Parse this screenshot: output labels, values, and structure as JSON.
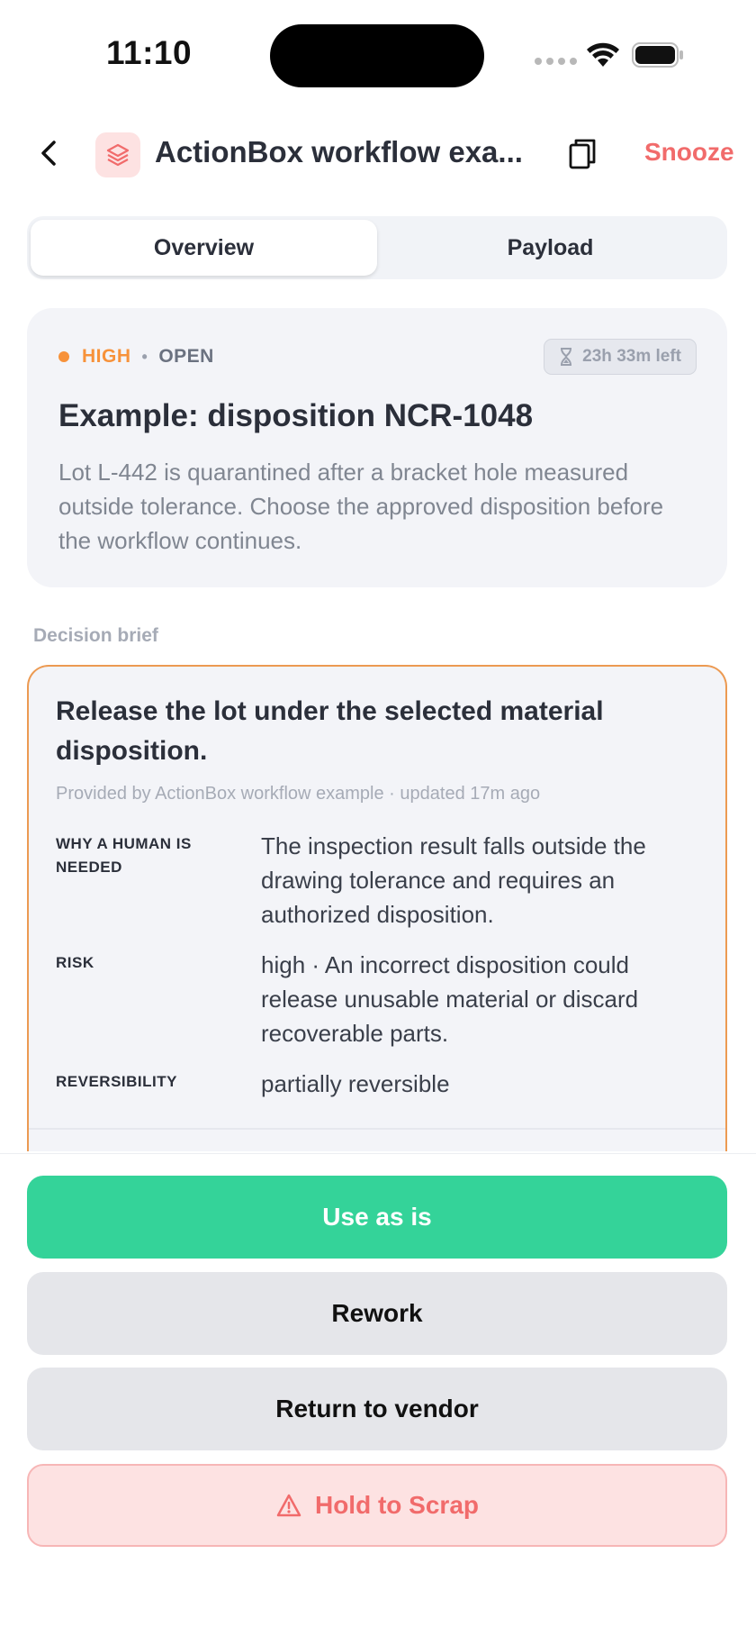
{
  "status_bar": {
    "time": "11:10"
  },
  "header": {
    "title": "ActionBox workflow exa...",
    "snooze_label": "Snooze"
  },
  "tabs": [
    {
      "label": "Overview",
      "active": true
    },
    {
      "label": "Payload",
      "active": false
    }
  ],
  "summary": {
    "priority": "HIGH",
    "separator": "•",
    "state": "OPEN",
    "time_left": "23h 33m left",
    "title": "Example: disposition NCR-1048",
    "description": "Lot L-442 is quarantined after a bracket hole measured outside tolerance. Choose the approved disposition before the workflow continues."
  },
  "decision_brief": {
    "section_label": "Decision brief",
    "title": "Release the lot under the selected material disposition.",
    "meta": "Provided by ActionBox workflow example · updated 17m ago",
    "fields": [
      {
        "key": "WHY A HUMAN IS NEEDED",
        "value": "The inspection result falls outside the drawing tolerance and requires an authorized disposition."
      },
      {
        "key": "RISK",
        "value": "high · An incorrect disposition could release unusable material or discard recoverable parts."
      },
      {
        "key": "REVERSIBILITY",
        "value": "partially reversible"
      }
    ]
  },
  "actions": {
    "primary": "Use as is",
    "rework": "Rework",
    "return_to_vendor": "Return to vendor",
    "scrap": "Hold to Scrap"
  },
  "colors": {
    "accent_red": "#f16b6b",
    "priority_orange": "#f7923a",
    "primary_green": "#34d399",
    "brief_border": "#ec9a52"
  }
}
